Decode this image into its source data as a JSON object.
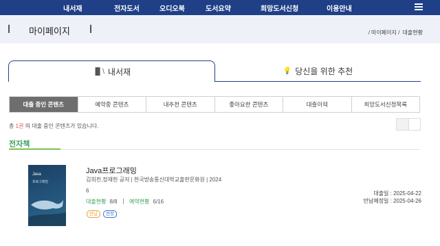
{
  "nav": {
    "items": [
      "내서재",
      "전자도서",
      "오디오북",
      "도서요약",
      "희망도서신청",
      "이용안내"
    ],
    "menu_icon": "hamburger-icon"
  },
  "pagehead": {
    "title": "마이페이지",
    "breadcrumb": [
      "마이페이지",
      "대출현황"
    ]
  },
  "main_tabs": [
    {
      "label": "내서재",
      "icon": "bookshelf-icon",
      "glyph": "▐▌\\",
      "active": true
    },
    {
      "label": "당신을 위한 추천",
      "icon": "lightbulb-icon",
      "glyph": "💡",
      "active": false
    }
  ],
  "sub_tabs": [
    {
      "label": "대출 중인 콘텐츠",
      "active": true
    },
    {
      "label": "예약중 콘텐츠",
      "active": false
    },
    {
      "label": "내추천 콘텐츠",
      "active": false
    },
    {
      "label": "좋아요한 콘텐츠",
      "active": false
    },
    {
      "label": "대출이력",
      "active": false
    },
    {
      "label": "희망도서신청목록",
      "active": false
    }
  ],
  "count": {
    "prefix": "총 ",
    "number": "1권",
    "suffix": " 의 대출 중인 콘텐츠가 있습니다."
  },
  "section": {
    "title": "전자책"
  },
  "book": {
    "cover_title": "Java",
    "cover_subtitle": "프로그래밍",
    "title": "Java프로그래밍",
    "meta": "김희천,정재헌 공저 | 한국방송통신대학교출판문화원 | 2024",
    "volume": "6",
    "loan_label": "대출현황",
    "loan_value": "8/8",
    "reserve_label": "예약현황",
    "reserve_value": "6/16",
    "badge_return": "반납",
    "badge_extend": "연장",
    "loan_date": "대출일 : 2025-04-22",
    "due_date": "반납예정일 : 2025-04-26"
  },
  "colors": {
    "nav_bg": "#1f3f86",
    "accent_green": "#3ba05a",
    "active_subtab": "#6e6e6e",
    "badge_return": "#e6a23c",
    "badge_extend": "#3b72c9"
  }
}
